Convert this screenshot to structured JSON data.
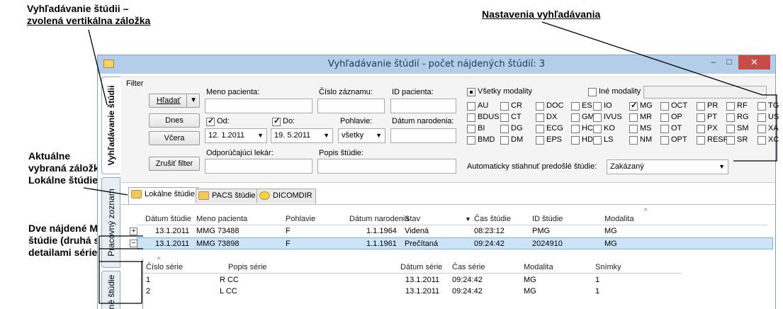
{
  "annotations": {
    "top_left_line1": "Vyhľadávanie štúdii –",
    "top_left_line2": "zvolená vertikálna záložka",
    "top_right": "Nastavenia vyhľadávania",
    "mid_left_line1": "Aktuálne",
    "mid_left_line2": "vybraná záložka",
    "mid_left_line3": "Lokálne štúdie",
    "bottom_left_line1": "Dve nájdené MG",
    "bottom_left_line2": "štúdie (druhá s",
    "bottom_left_line3": "detailami série)"
  },
  "window": {
    "title": "Vyhľadávanie štúdií - počet nájdených štúdií: 3",
    "minimize": "–",
    "maximize": "□",
    "close": "✕"
  },
  "vertical_tabs": {
    "search": "Vyhľadávanie štúdii",
    "worklist": "Pracovný zoznam",
    "other": "né štúdie"
  },
  "filter": {
    "group_label": "Filter",
    "search_button": "Hľadať",
    "today_button": "Dnes",
    "yesterday_button": "Včera",
    "clear_button": "Zrušiť filter",
    "patient_name_label": "Meno pacienta:",
    "patient_name_value": "",
    "record_number_label": "Číslo záznamu:",
    "record_number_value": "",
    "patient_id_label": "ID pacienta:",
    "patient_id_value": "",
    "from_label": "Od:",
    "from_value": "12. 1.2011",
    "to_label": "Do:",
    "to_value": "19. 5.2011",
    "gender_label": "Pohlavie:",
    "gender_value": "všetky",
    "birth_date_label": "Dátum narodenia:",
    "birth_date_value": "",
    "referring_label": "Odporúčajúci lekár:",
    "referring_value": "",
    "study_desc_label": "Popis štúdie:",
    "study_desc_value": "",
    "all_modalities_label": "Všetky modality",
    "other_modalities_label": "Iné modality",
    "other_modalities_value": "",
    "auto_download_label": "Automaticky stiahnuť predošlé štúdie:",
    "auto_download_value": "Zakázaný",
    "modalities": [
      {
        "label": "AU",
        "checked": false
      },
      {
        "label": "CR",
        "checked": false
      },
      {
        "label": "DOC",
        "checked": false
      },
      {
        "label": "ES",
        "checked": false
      },
      {
        "label": "IO",
        "checked": false
      },
      {
        "label": "MG",
        "checked": true
      },
      {
        "label": "OCT",
        "checked": false
      },
      {
        "label": "PR",
        "checked": false
      },
      {
        "label": "RF",
        "checked": false
      },
      {
        "label": "TG",
        "checked": false
      },
      {
        "label": "BDUS",
        "checked": false
      },
      {
        "label": "CT",
        "checked": false
      },
      {
        "label": "DX",
        "checked": false
      },
      {
        "label": "GM",
        "checked": false
      },
      {
        "label": "IVUS",
        "checked": false
      },
      {
        "label": "MR",
        "checked": false
      },
      {
        "label": "OP",
        "checked": false
      },
      {
        "label": "PT",
        "checked": false
      },
      {
        "label": "RG",
        "checked": false
      },
      {
        "label": "US",
        "checked": false
      },
      {
        "label": "BI",
        "checked": false
      },
      {
        "label": "DG",
        "checked": false
      },
      {
        "label": "ECG",
        "checked": false
      },
      {
        "label": "HC",
        "checked": false
      },
      {
        "label": "KO",
        "checked": false
      },
      {
        "label": "MS",
        "checked": false
      },
      {
        "label": "OT",
        "checked": false
      },
      {
        "label": "PX",
        "checked": false
      },
      {
        "label": "SM",
        "checked": false
      },
      {
        "label": "XA",
        "checked": false
      },
      {
        "label": "BMD",
        "checked": false
      },
      {
        "label": "DM",
        "checked": false
      },
      {
        "label": "EPS",
        "checked": false
      },
      {
        "label": "HD",
        "checked": false
      },
      {
        "label": "LS",
        "checked": false
      },
      {
        "label": "NM",
        "checked": false
      },
      {
        "label": "OPT",
        "checked": false
      },
      {
        "label": "RESP",
        "checked": false
      },
      {
        "label": "SR",
        "checked": false
      },
      {
        "label": "XC",
        "checked": false
      }
    ]
  },
  "tabs": [
    "Lokálne štúdie",
    "PACS štúdie",
    "DICOMDIR"
  ],
  "studies": {
    "headers": [
      "Dátum štúdie",
      "Meno pacienta",
      "Pohlavie",
      "Dátum narodenia",
      "Stav",
      "Čas štúdie",
      "ID štúdie",
      "Modalita"
    ],
    "rows": [
      {
        "toggle": "+",
        "date": "13.1.2011",
        "name": "MMG 73488",
        "gender": "F",
        "birth": "1.1.1964",
        "status": "Videná",
        "time": "08:23:12",
        "id": "PMG",
        "modality": "MG"
      },
      {
        "toggle": "−",
        "date": "13.1.2011",
        "name": "MMG 73898",
        "gender": "F",
        "birth": "1.1.1961",
        "status": "Prečítaná",
        "time": "09:24:42",
        "id": "2024910",
        "modality": "MG"
      }
    ]
  },
  "series": {
    "headers": [
      "Číslo série",
      "Popis série",
      "Dátum série",
      "Čas série",
      "Modalita",
      "Snímky"
    ],
    "rows": [
      {
        "num": "1",
        "desc": "R CC",
        "date": "13.1.2011",
        "time": "09:24:42",
        "modality": "MG",
        "images": "1"
      },
      {
        "num": "2",
        "desc": "L CC",
        "date": "13.1.2011",
        "time": "09:24:42",
        "modality": "MG",
        "images": "1"
      }
    ]
  },
  "colors": {
    "titlebar": "#b4cde9",
    "selected_row": "#cde4f7",
    "close": "#c74b46"
  }
}
